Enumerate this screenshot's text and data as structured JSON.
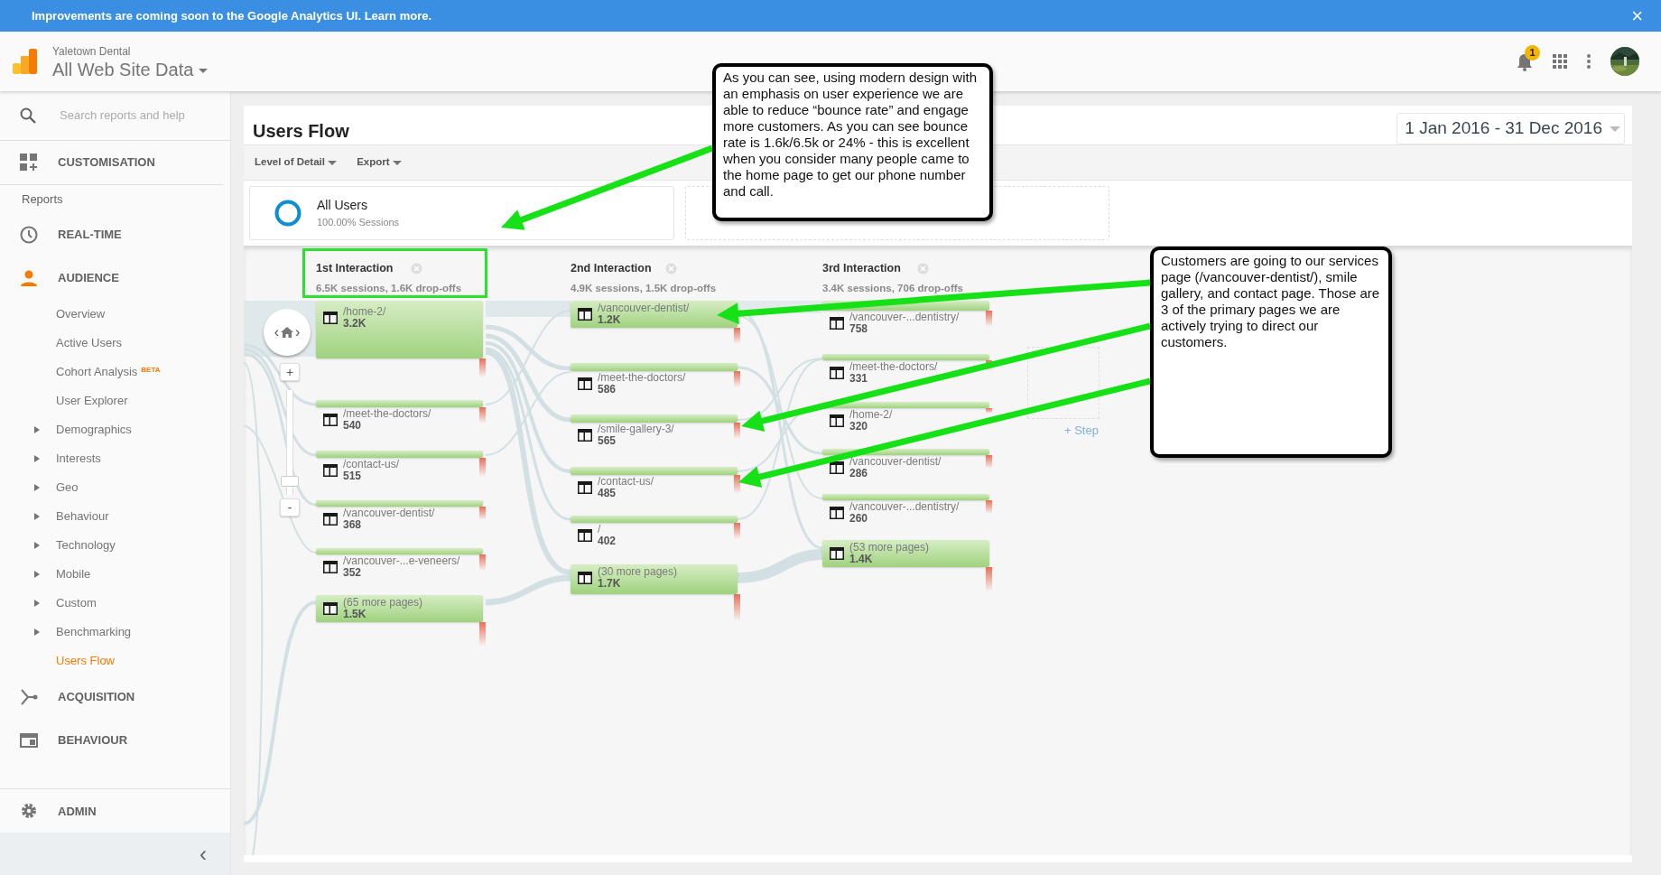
{
  "banner": {
    "text": "Improvements are coming soon to the Google Analytics UI.",
    "link": "Learn more",
    "after": ".",
    "close": "×"
  },
  "header": {
    "account": "Yaletown Dental",
    "property": "All Web Site Data",
    "notifications": "1"
  },
  "sidebar": {
    "search": {
      "placeholder": "Search reports and help"
    },
    "customisation": {
      "label": "CUSTOMISATION",
      "active": false
    },
    "reports_label": "Reports",
    "real_time": {
      "label": "REAL-TIME",
      "active": false
    },
    "audience": {
      "label": "AUDIENCE",
      "active": true,
      "children": [
        {
          "kind": "link",
          "label": "Overview",
          "selected": false
        },
        {
          "kind": "link",
          "label": "Active Users",
          "selected": false
        },
        {
          "kind": "link",
          "label": "Cohort Analysis",
          "badge": "BETA",
          "selected": false
        },
        {
          "kind": "link",
          "label": "User Explorer",
          "selected": false
        },
        {
          "kind": "group",
          "label": "Demographics",
          "expanded": false,
          "selected": false
        },
        {
          "kind": "group",
          "label": "Interests",
          "expanded": false,
          "selected": false
        },
        {
          "kind": "group",
          "label": "Geo",
          "expanded": false,
          "selected": false
        },
        {
          "kind": "group",
          "label": "Behaviour",
          "expanded": false,
          "selected": false
        },
        {
          "kind": "group",
          "label": "Technology",
          "expanded": false,
          "selected": false
        },
        {
          "kind": "group",
          "label": "Mobile",
          "expanded": false,
          "selected": false
        },
        {
          "kind": "group",
          "label": "Custom",
          "expanded": false,
          "selected": false
        },
        {
          "kind": "group",
          "label": "Benchmarking",
          "expanded": false,
          "selected": false
        },
        {
          "kind": "link",
          "label": "Users Flow",
          "selected": true
        }
      ]
    },
    "acquisition": {
      "label": "ACQUISITION",
      "active": false
    },
    "behaviour": {
      "label": "BEHAVIOUR",
      "active": false
    },
    "admin": {
      "label": "ADMIN",
      "active": false
    },
    "collapse": "‹"
  },
  "report": {
    "title": "Users Flow",
    "date_range": "1 Jan 2016 - 31 Dec 2016",
    "toolbar": [
      {
        "label": "Level of Detail"
      },
      {
        "label": "Export"
      }
    ],
    "segment": {
      "name": "All Users",
      "share": "100.00% Sessions"
    },
    "flow": {
      "nav": {
        "prev": "‹",
        "next": "›"
      },
      "zoom": {
        "plus": "+",
        "minus": "-",
        "level": 0.05
      },
      "columns": [
        {
          "title": "1st Interaction",
          "summary": "6.5K sessions, 1.6K drop-offs",
          "highlighted": true,
          "nodes": [
            {
              "page": "/home-2/",
              "count": "3.2K"
            },
            {
              "page": "/meet-the-doctors/",
              "count": "540"
            },
            {
              "page": "/contact-us/",
              "count": "515"
            },
            {
              "page": "/vancouver-dentist/",
              "count": "368"
            },
            {
              "page": "/vancouver-...e-veneers/",
              "count": "352"
            },
            {
              "page": "(65 more pages)",
              "count": "1.5K"
            }
          ]
        },
        {
          "title": "2nd Interaction",
          "summary": "4.9K sessions, 1.5K drop-offs",
          "highlighted": false,
          "nodes": [
            {
              "page": "/vancouver-dentist/",
              "count": "1.2K"
            },
            {
              "page": "/meet-the-doctors/",
              "count": "586"
            },
            {
              "page": "/smile-gallery-3/",
              "count": "565"
            },
            {
              "page": "/contact-us/",
              "count": "485"
            },
            {
              "page": "/",
              "count": "402"
            },
            {
              "page": "(30 more pages)",
              "count": "1.7K"
            }
          ]
        },
        {
          "title": "3rd Interaction",
          "summary": "3.4K sessions, 706 drop-offs",
          "highlighted": false,
          "nodes": [
            {
              "page": "/vancouver-...dentistry/",
              "count": "758"
            },
            {
              "page": "/meet-the-doctors/",
              "count": "331"
            },
            {
              "page": "/home-2/",
              "count": "320"
            },
            {
              "page": "/vancouver-dentist/",
              "count": "286"
            },
            {
              "page": "/vancouver-...dentistry/",
              "count": "260"
            },
            {
              "page": "(53 more pages)",
              "count": "1.4K"
            }
          ]
        }
      ],
      "add_step": "+ Step"
    }
  },
  "annotations": [
    {
      "text": "As you can see, using modern design with an emphasis on user experience we are able to reduce “bounce rate” and engage more customers. As you can see bounce rate is 1.6k/6.5k or 24% - this is excellent when you consider many people came to the home page to get our phone number and call."
    },
    {
      "text": "Customers are going to our services page (/vancouver-dentist/), smile gallery, and contact page. Those are 3 of the primary pages we are actively trying to direct our customers."
    }
  ]
}
